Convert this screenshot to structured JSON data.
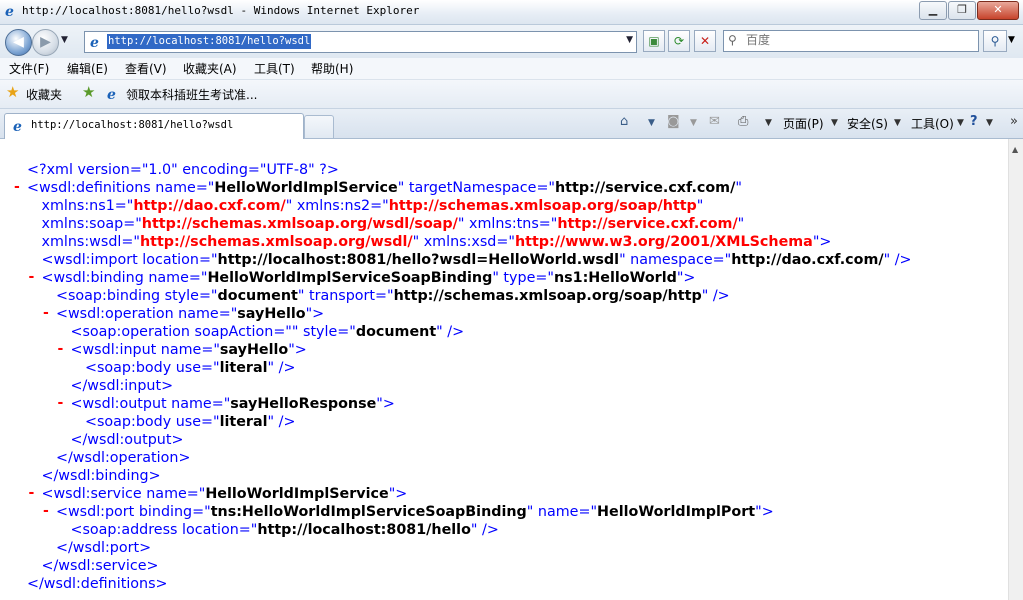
{
  "window": {
    "title": "http://localhost:8081/hello?wsdl - Windows Internet Explorer"
  },
  "address": {
    "url": "http://localhost:8081/hello?wsdl"
  },
  "search": {
    "placeholder": "百度"
  },
  "menu": [
    "文件(F)",
    "编辑(E)",
    "查看(V)",
    "收藏夹(A)",
    "工具(T)",
    "帮助(H)"
  ],
  "favorites": {
    "label": "收藏夹",
    "link": "领取本科插班生考试准..."
  },
  "tab": {
    "label": "http://localhost:8081/hello?wsdl"
  },
  "commands": {
    "page": "页面(P)",
    "safety": "安全(S)",
    "tools": "工具(O)"
  },
  "xml": [
    {
      "indent": 0,
      "minus": false,
      "parts": [
        [
          "m",
          "<?xml version=\"1.0\" encoding=\"UTF-8\" ?>"
        ]
      ]
    },
    {
      "indent": 0,
      "minus": true,
      "parts": [
        [
          "m",
          "<wsdl:definitions "
        ],
        [
          "m",
          "name=\""
        ],
        [
          "v",
          "HelloWorldImplService"
        ],
        [
          "m",
          "\" targetNamespace=\""
        ],
        [
          "v",
          "http://service.cxf.com/"
        ],
        [
          "m",
          "\""
        ]
      ]
    },
    {
      "indent": 1,
      "minus": false,
      "parts": [
        [
          "m",
          "xmlns:ns1=\""
        ],
        [
          "ns",
          "http://dao.cxf.com/"
        ],
        [
          "m",
          "\" xmlns:ns2=\""
        ],
        [
          "ns",
          "http://schemas.xmlsoap.org/soap/http"
        ],
        [
          "m",
          "\""
        ]
      ]
    },
    {
      "indent": 1,
      "minus": false,
      "parts": [
        [
          "m",
          "xmlns:soap=\""
        ],
        [
          "ns",
          "http://schemas.xmlsoap.org/wsdl/soap/"
        ],
        [
          "m",
          "\" xmlns:tns=\""
        ],
        [
          "ns",
          "http://service.cxf.com/"
        ],
        [
          "m",
          "\""
        ]
      ]
    },
    {
      "indent": 1,
      "minus": false,
      "parts": [
        [
          "m",
          "xmlns:wsdl=\""
        ],
        [
          "ns",
          "http://schemas.xmlsoap.org/wsdl/"
        ],
        [
          "m",
          "\" xmlns:xsd=\""
        ],
        [
          "ns",
          "http://www.w3.org/2001/XMLSchema"
        ],
        [
          "m",
          "\">"
        ]
      ]
    },
    {
      "indent": 1,
      "minus": false,
      "parts": [
        [
          "m",
          "<wsdl:import location=\""
        ],
        [
          "v",
          "http://localhost:8081/hello?wsdl=HelloWorld.wsdl"
        ],
        [
          "m",
          "\" namespace=\""
        ],
        [
          "v",
          "http://dao.cxf.com/"
        ],
        [
          "m",
          "\" />"
        ]
      ]
    },
    {
      "indent": 1,
      "minus": true,
      "parts": [
        [
          "m",
          "<wsdl:binding name=\""
        ],
        [
          "v",
          "HelloWorldImplServiceSoapBinding"
        ],
        [
          "m",
          "\" type=\""
        ],
        [
          "v",
          "ns1:HelloWorld"
        ],
        [
          "m",
          "\">"
        ]
      ]
    },
    {
      "indent": 2,
      "minus": false,
      "parts": [
        [
          "m",
          "<soap:binding style=\""
        ],
        [
          "v",
          "document"
        ],
        [
          "m",
          "\" transport=\""
        ],
        [
          "v",
          "http://schemas.xmlsoap.org/soap/http"
        ],
        [
          "m",
          "\" />"
        ]
      ]
    },
    {
      "indent": 2,
      "minus": true,
      "parts": [
        [
          "m",
          "<wsdl:operation name=\""
        ],
        [
          "v",
          "sayHello"
        ],
        [
          "m",
          "\">"
        ]
      ]
    },
    {
      "indent": 3,
      "minus": false,
      "parts": [
        [
          "m",
          "<soap:operation soapAction=\"\" style=\""
        ],
        [
          "v",
          "document"
        ],
        [
          "m",
          "\" />"
        ]
      ]
    },
    {
      "indent": 3,
      "minus": true,
      "parts": [
        [
          "m",
          "<wsdl:input name=\""
        ],
        [
          "v",
          "sayHello"
        ],
        [
          "m",
          "\">"
        ]
      ]
    },
    {
      "indent": 4,
      "minus": false,
      "parts": [
        [
          "m",
          "<soap:body use=\""
        ],
        [
          "v",
          "literal"
        ],
        [
          "m",
          "\" />"
        ]
      ]
    },
    {
      "indent": 3,
      "minus": false,
      "parts": [
        [
          "m",
          "</wsdl:input>"
        ]
      ]
    },
    {
      "indent": 3,
      "minus": true,
      "parts": [
        [
          "m",
          "<wsdl:output name=\""
        ],
        [
          "v",
          "sayHelloResponse"
        ],
        [
          "m",
          "\">"
        ]
      ]
    },
    {
      "indent": 4,
      "minus": false,
      "parts": [
        [
          "m",
          "<soap:body use=\""
        ],
        [
          "v",
          "literal"
        ],
        [
          "m",
          "\" />"
        ]
      ]
    },
    {
      "indent": 3,
      "minus": false,
      "parts": [
        [
          "m",
          "</wsdl:output>"
        ]
      ]
    },
    {
      "indent": 2,
      "minus": false,
      "parts": [
        [
          "m",
          "</wsdl:operation>"
        ]
      ]
    },
    {
      "indent": 1,
      "minus": false,
      "parts": [
        [
          "m",
          "</wsdl:binding>"
        ]
      ]
    },
    {
      "indent": 1,
      "minus": true,
      "parts": [
        [
          "m",
          "<wsdl:service name=\""
        ],
        [
          "v",
          "HelloWorldImplService"
        ],
        [
          "m",
          "\">"
        ]
      ]
    },
    {
      "indent": 2,
      "minus": true,
      "parts": [
        [
          "m",
          "<wsdl:port binding=\""
        ],
        [
          "v",
          "tns:HelloWorldImplServiceSoapBinding"
        ],
        [
          "m",
          "\" name=\""
        ],
        [
          "v",
          "HelloWorldImplPort"
        ],
        [
          "m",
          "\">"
        ]
      ]
    },
    {
      "indent": 3,
      "minus": false,
      "parts": [
        [
          "m",
          "<soap:address location=\""
        ],
        [
          "v",
          "http://localhost:8081/hello"
        ],
        [
          "m",
          "\" />"
        ]
      ]
    },
    {
      "indent": 2,
      "minus": false,
      "parts": [
        [
          "m",
          "</wsdl:port>"
        ]
      ]
    },
    {
      "indent": 1,
      "minus": false,
      "parts": [
        [
          "m",
          "</wsdl:service>"
        ]
      ]
    },
    {
      "indent": 0,
      "minus": false,
      "parts": [
        [
          "m",
          "</wsdl:definitions>"
        ]
      ]
    }
  ]
}
